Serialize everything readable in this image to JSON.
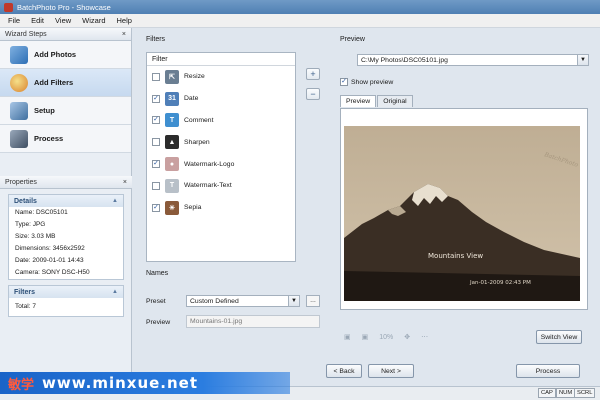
{
  "window": {
    "title": "BatchPhoto Pro - Showcase"
  },
  "menu": [
    "File",
    "Edit",
    "View",
    "Wizard",
    "Help"
  ],
  "wizard": {
    "header": "Wizard Steps",
    "close_icon": "×",
    "steps": [
      {
        "label": "Add Photos",
        "icon": "add-photos-icon",
        "active": false
      },
      {
        "label": "Add Filters",
        "icon": "add-filters-icon",
        "active": true
      },
      {
        "label": "Setup",
        "icon": "setup-icon",
        "active": false
      },
      {
        "label": "Process",
        "icon": "process-icon",
        "active": false
      }
    ]
  },
  "properties": {
    "header": "Properties",
    "close_icon": "×",
    "details": {
      "title": "Details",
      "rows": [
        "Name: DSC05101",
        "Type: JPG",
        "Size: 3.03 MB",
        "Dimensions: 3456x2592",
        "Date: 2009-01-01 14:43",
        "Camera: SONY DSC-H50"
      ]
    },
    "filters": {
      "title": "Filters",
      "total": "Total: 7"
    }
  },
  "filters": {
    "label": "Filters",
    "list_header": "Filter",
    "items": [
      {
        "name": "Resize",
        "checked": false,
        "icon": "resize-icon",
        "color": "#6a7e92"
      },
      {
        "name": "Date",
        "checked": true,
        "icon": "date-icon",
        "color": "#4f7fb8"
      },
      {
        "name": "Comment",
        "checked": true,
        "icon": "comment-icon",
        "color": "#3f8fd0"
      },
      {
        "name": "Sharpen",
        "checked": false,
        "icon": "sharpen-icon",
        "color": "#2b2b2b"
      },
      {
        "name": "Watermark-Logo",
        "checked": true,
        "icon": "watermark-logo-icon",
        "color": "#c9a0a0"
      },
      {
        "name": "Watermark-Text",
        "checked": false,
        "icon": "watermark-text-icon",
        "color": "#b8c0c8"
      },
      {
        "name": "Sepia",
        "checked": true,
        "icon": "sepia-icon",
        "color": "#8a5a3a"
      }
    ],
    "add_symbol": "+",
    "remove_symbol": "−"
  },
  "names": {
    "label": "Names",
    "preset_label": "Preset",
    "preset_value": "Custom Defined",
    "preview_label": "Preview",
    "preview_value": "Mountains-01.jpg"
  },
  "preview": {
    "label": "Preview",
    "path": "C:\\My Photos\\DSC05101.jpg",
    "show_preview_label": "Show preview",
    "show_preview_checked": true,
    "tabs": [
      "Preview",
      "Original"
    ],
    "active_tab": "Preview",
    "photo_caption": "Mountains View",
    "photo_date": "Jan-01-2009 02:43 PM",
    "photo_logo": "BatchPhoto",
    "zoom": "10%",
    "switch_view": "Switch View"
  },
  "nav": {
    "back": "< Back",
    "next": "Next >",
    "process": "Process"
  },
  "status": [
    "CAP",
    "NUM",
    "SCRL"
  ],
  "watermark": {
    "logo": "敏学",
    "url": "www.minxue.net"
  },
  "colors": {
    "accent": "#4f7fb3",
    "sepia_dark": "#3b2e22",
    "sepia_light": "#cbbba4",
    "banner": "#1a64c8"
  }
}
